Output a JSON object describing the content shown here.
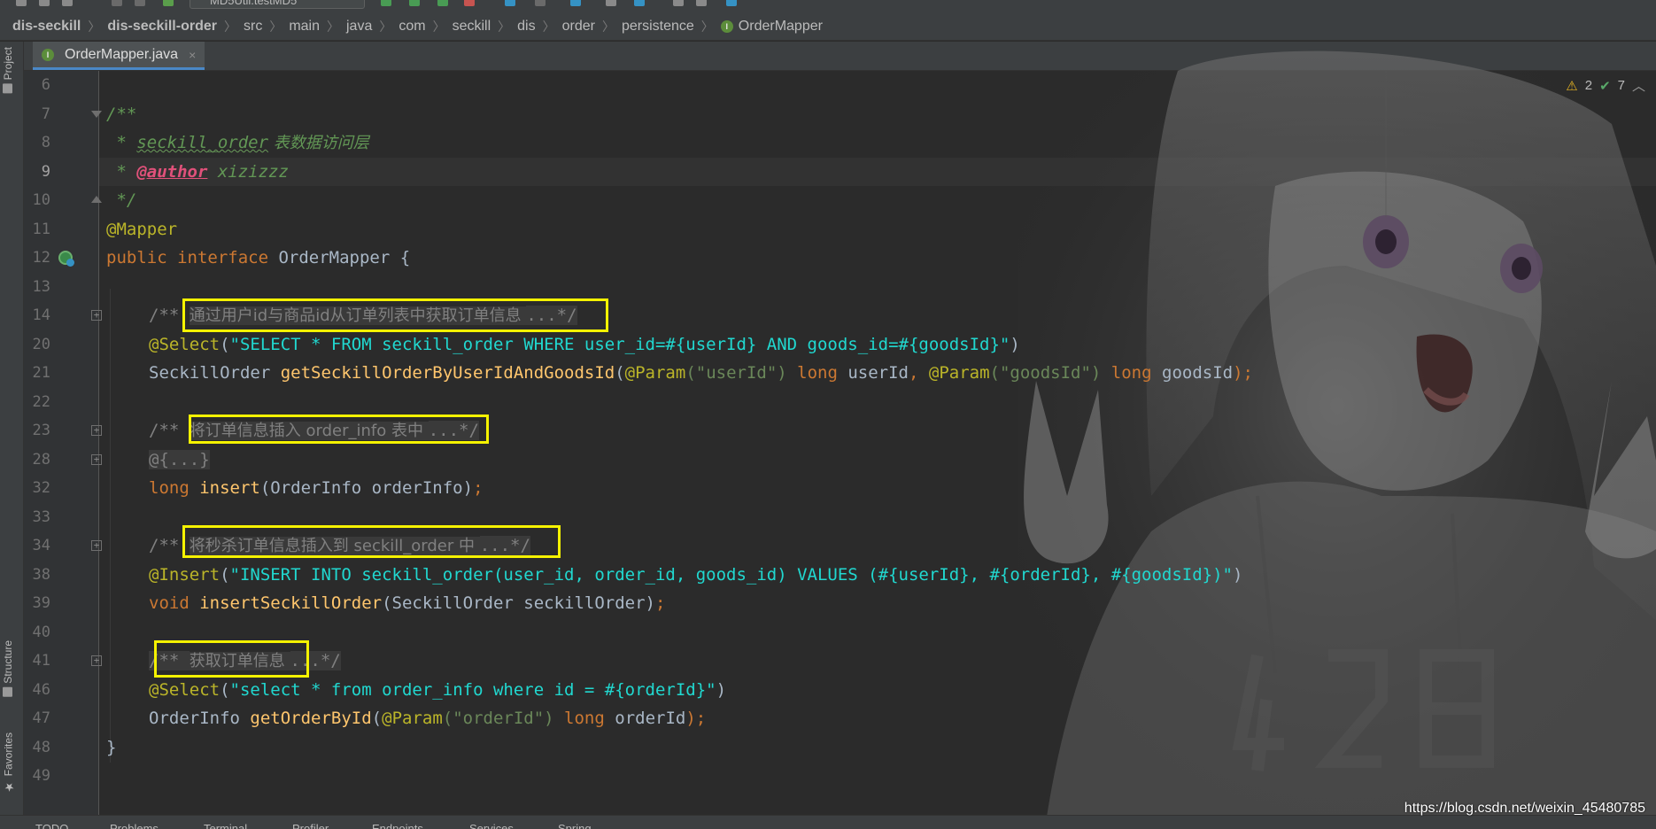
{
  "toolbar": {
    "run_config": "MD5Util.testMD5"
  },
  "breadcrumb": [
    "dis-seckill",
    "dis-seckill-order",
    "src",
    "main",
    "java",
    "com",
    "seckill",
    "dis",
    "order",
    "persistence",
    "OrderMapper"
  ],
  "left_panel": {
    "project_label": "Project",
    "structure_label": "Structure",
    "favorites_label": "Favorites"
  },
  "tab": {
    "title": "OrderMapper.java",
    "close": "×"
  },
  "inspection": {
    "warnings": "2",
    "ok": "7"
  },
  "line_numbers": [
    "6",
    "7",
    "8",
    "9",
    "10",
    "11",
    "12",
    "13",
    "14",
    "20",
    "21",
    "22",
    "23",
    "28",
    "32",
    "33",
    "34",
    "38",
    "39",
    "40",
    "41",
    "46",
    "47",
    "48",
    "49"
  ],
  "code": {
    "l7": "/**",
    "l8_star": " * ",
    "l8_table": "seckill_order",
    "l8_desc": " 表数据访问层",
    "l9_star": " * ",
    "l9_tag": "@author",
    "l9_name": " xizizzz",
    "l10": " */",
    "l11": "@Mapper",
    "l12_public": "public ",
    "l12_interface": "interface ",
    "l12_name": "OrderMapper {",
    "l14_open": "/** ",
    "l14_text": "通过用户id与商品id从订单列表中获取订单信息 ",
    "l14_close": "...*/",
    "l20_ann": "@Select",
    "l20_p": "(",
    "l20_str": "\"SELECT * FROM seckill_order WHERE user_id=#{userId} AND goods_id=#{goodsId}\"",
    "l20_end": ")",
    "l21_type": "SeckillOrder ",
    "l21_fn": "getSeckillOrderByUserIdAndGoodsId",
    "l21_a": "(",
    "l21_ann1": "@Param",
    "l21_s1": "(\"userId\")",
    "l21_k1": " long ",
    "l21_v1": "userId",
    "l21_c": ", ",
    "l21_ann2": "@Param",
    "l21_s2": "(\"goodsId\")",
    "l21_k2": " long ",
    "l21_v2": "goodsId",
    "l21_end": ");",
    "l23_open": "/** ",
    "l23_text": "将订单信息插入 order_info 表中 ",
    "l23_close": "...*/",
    "l28": "@{...}",
    "l32_kw": "long ",
    "l32_fn": "insert",
    "l32_rest": "(OrderInfo orderInfo)",
    "l32_end": ";",
    "l34_open": "/** ",
    "l34_text": "将秒杀订单信息插入到 seckill_order 中 ",
    "l34_close": "...*/",
    "l38_ann": "@Insert",
    "l38_p": "(",
    "l38_str": "\"INSERT INTO seckill_order(user_id, order_id, goods_id) VALUES (#{userId}, #{orderId}, #{goodsId})\"",
    "l38_end": ")",
    "l39_kw": "void ",
    "l39_fn": "insertSeckillOrder",
    "l39_rest": "(SeckillOrder seckillOrder)",
    "l39_end": ";",
    "l41_open": "/** ",
    "l41_text": "获取订单信息 ",
    "l41_close": "...*/",
    "l46_ann": "@Select",
    "l46_p": "(",
    "l46_str": "\"select * from order_info where id = #{orderId}\"",
    "l46_end": ")",
    "l47_type": "OrderInfo ",
    "l47_fn": "getOrderById",
    "l47_a": "(",
    "l47_ann": "@Param",
    "l47_s": "(\"orderId\")",
    "l47_k": " long ",
    "l47_v": "orderId",
    "l47_end": ");",
    "l48": "}"
  },
  "bottom_tools": [
    "TODO",
    "Problems",
    "Terminal",
    "Profiler",
    "Endpoints",
    "Services",
    "Spring"
  ],
  "watermark": "https://blog.csdn.net/weixin_45480785",
  "colors": {
    "keyword": "#cc7832",
    "annotation": "#bbb529",
    "sql_string": "#21d8d0",
    "method": "#ffc66d",
    "doc_comment": "#629755",
    "highlight_box": "#f5f200"
  }
}
